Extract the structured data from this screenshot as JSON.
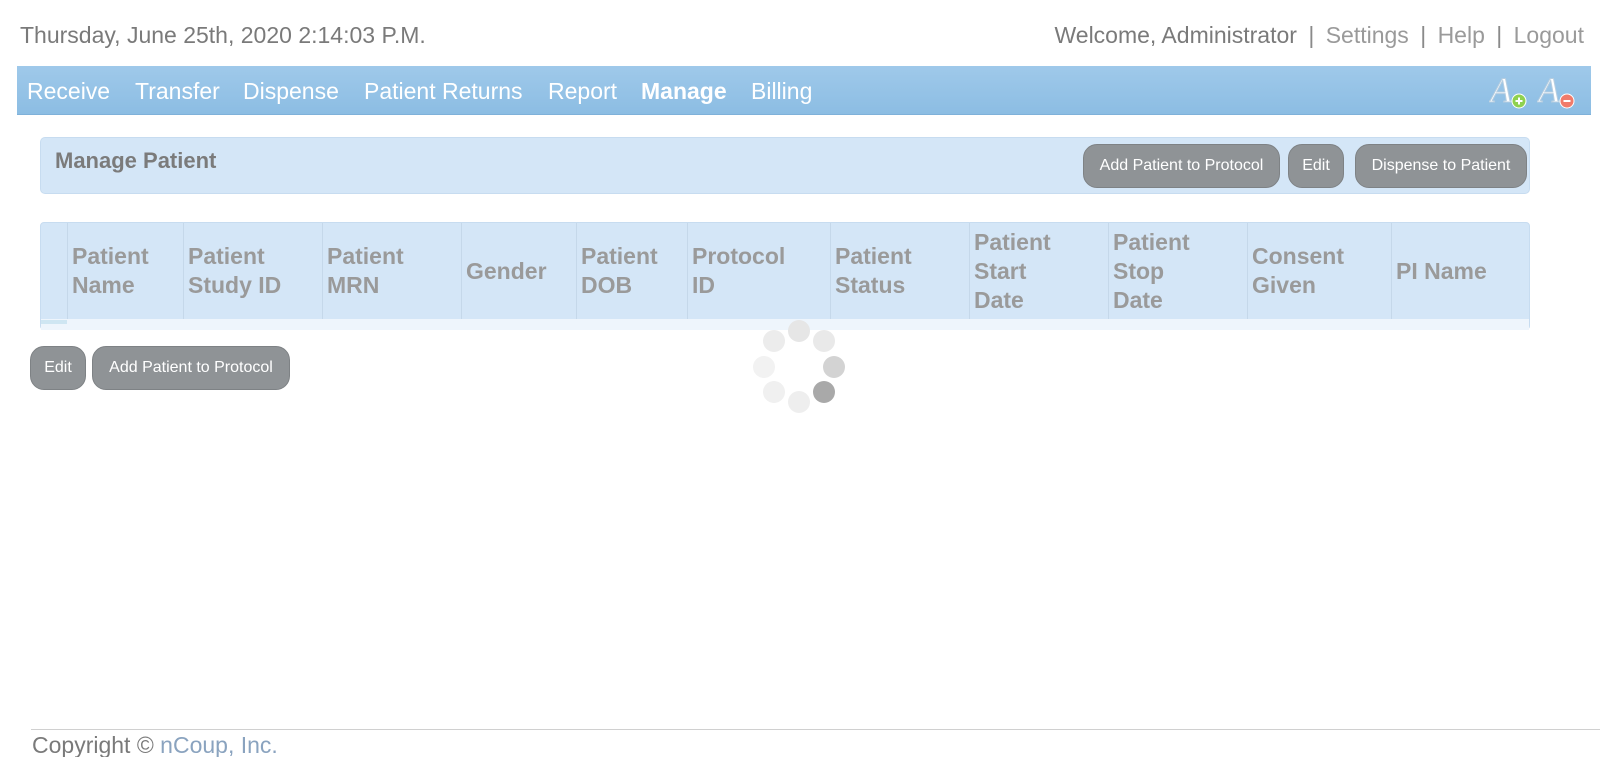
{
  "header": {
    "datetime": "Thursday, June 25th, 2020 2:14:03 P.M.",
    "welcome": "Welcome, Administrator",
    "links": {
      "settings": "Settings",
      "help": "Help",
      "logout": "Logout"
    },
    "separator": "|"
  },
  "nav": {
    "items": [
      "Receive",
      "Transfer",
      "Dispense",
      "Patient Returns",
      "Report",
      "Manage",
      "Billing"
    ],
    "active": "Manage",
    "font_controls": {
      "increase_icon": "font-increase-icon",
      "decrease_icon": "font-decrease-icon"
    }
  },
  "panel": {
    "title": "Manage Patient",
    "buttons": {
      "add_protocol": "Add Patient to Protocol",
      "edit": "Edit",
      "dispense": "Dispense to Patient"
    }
  },
  "table": {
    "columns": [
      [
        "Patient",
        "Name"
      ],
      [
        "Patient",
        "Study ID"
      ],
      [
        "Patient",
        "MRN"
      ],
      [
        "Gender"
      ],
      [
        "Patient",
        "DOB"
      ],
      [
        "Protocol",
        "ID"
      ],
      [
        "Patient",
        "Status"
      ],
      [
        "Patient",
        "Start",
        "Date"
      ],
      [
        "Patient",
        "Stop",
        "Date"
      ],
      [
        "Consent",
        "Given"
      ],
      [
        "PI Name"
      ]
    ],
    "rows": []
  },
  "actions": {
    "edit": "Edit",
    "add_protocol": "Add Patient to Protocol"
  },
  "loading": {
    "icon": "loading-spinner-icon"
  },
  "footer": {
    "copyright": "Copyright ©",
    "company": "nCoup, Inc."
  },
  "colors": {
    "nav_bg": "#8fbfe4",
    "panel_bg": "#d4e6f7",
    "button_bg": "#8f9396",
    "text": "#7a7a7a"
  }
}
